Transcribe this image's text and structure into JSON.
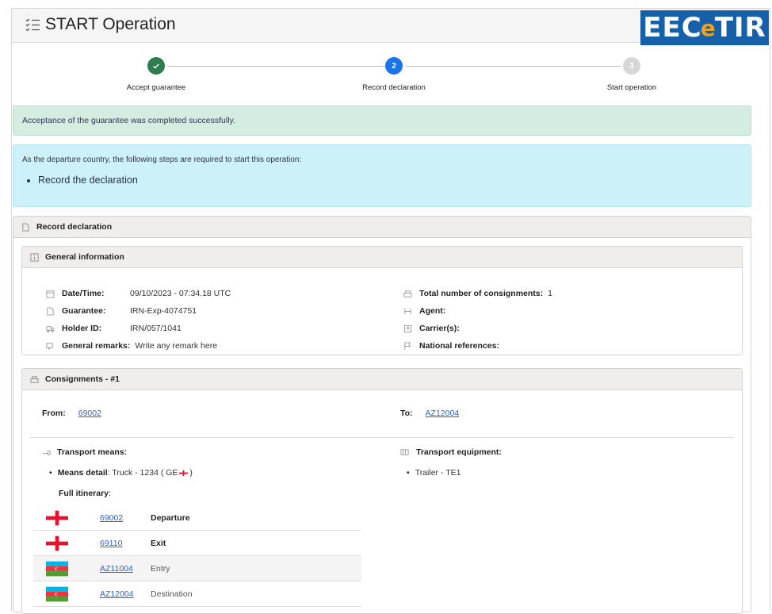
{
  "header": {
    "title": "START Operation",
    "logo_text_a": "EEC",
    "logo_text_e": "e",
    "logo_text_b": "TIR"
  },
  "stepper": {
    "steps": [
      {
        "label": "Accept guarantee",
        "state": "done",
        "mark": ""
      },
      {
        "label": "Record declaration",
        "state": "active",
        "mark": "2"
      },
      {
        "label": "Start operation",
        "state": "pending",
        "mark": "3"
      }
    ]
  },
  "alerts": {
    "success": "Acceptance of the guarantee was completed successfully.",
    "info": "As the departure country, the following steps are required to start this operation:",
    "info_items": [
      "Record the declaration"
    ]
  },
  "record": {
    "title": "Record declaration",
    "general": {
      "title": "General information",
      "left": [
        {
          "key": "Date/Time:",
          "value": "09/10/2023 - 07:34.18 UTC",
          "icon": "calendar-icon"
        },
        {
          "key": "Guarantee:",
          "value": "IRN-Exp-4074751",
          "icon": "document-icon"
        },
        {
          "key": "Holder ID:",
          "value": "IRN/057/1041",
          "icon": "truck-icon"
        },
        {
          "key": "General remarks:",
          "value": "Write any remark here",
          "icon": "comment-icon"
        }
      ],
      "right": [
        {
          "key": "Total number of consignments:",
          "value": "1",
          "icon": "boxes-icon"
        },
        {
          "key": "Agent:",
          "value": "",
          "icon": "agent-icon"
        },
        {
          "key": "Carrier(s):",
          "value": "",
          "icon": "carrier-icon"
        },
        {
          "key": "National references:",
          "value": "",
          "icon": "flag-icon"
        }
      ]
    },
    "consignments": {
      "title": "Consignments - #1",
      "from_label": "From:",
      "from_value": "69002",
      "to_label": "To:",
      "to_value": "AZ12004",
      "transport_means_label": "Transport means:",
      "means_detail_label": "Means detail",
      "means_detail_value": ": Truck - 1234 ( GE ",
      "means_detail_close": " )",
      "transport_equipment_label": "Transport equipment:",
      "equipment_item": "Trailer - TE1",
      "full_itinerary_label": "Full itinerary",
      "full_itinerary_colon": ":",
      "itinerary": [
        {
          "flag": "GE",
          "code": "69002",
          "event": "Departure",
          "bold": true
        },
        {
          "flag": "GE",
          "code": "69110",
          "event": "Exit",
          "bold": true
        },
        {
          "flag": "AZ",
          "code": "AZ11004",
          "event": "Entry",
          "bold": false
        },
        {
          "flag": "AZ",
          "code": "AZ12004",
          "event": "Destination",
          "bold": false
        }
      ]
    }
  },
  "colors": {
    "done": "#2e7d4f",
    "active": "#1a73e8",
    "pending": "#d6d6d6",
    "link": "#2b63d4"
  }
}
